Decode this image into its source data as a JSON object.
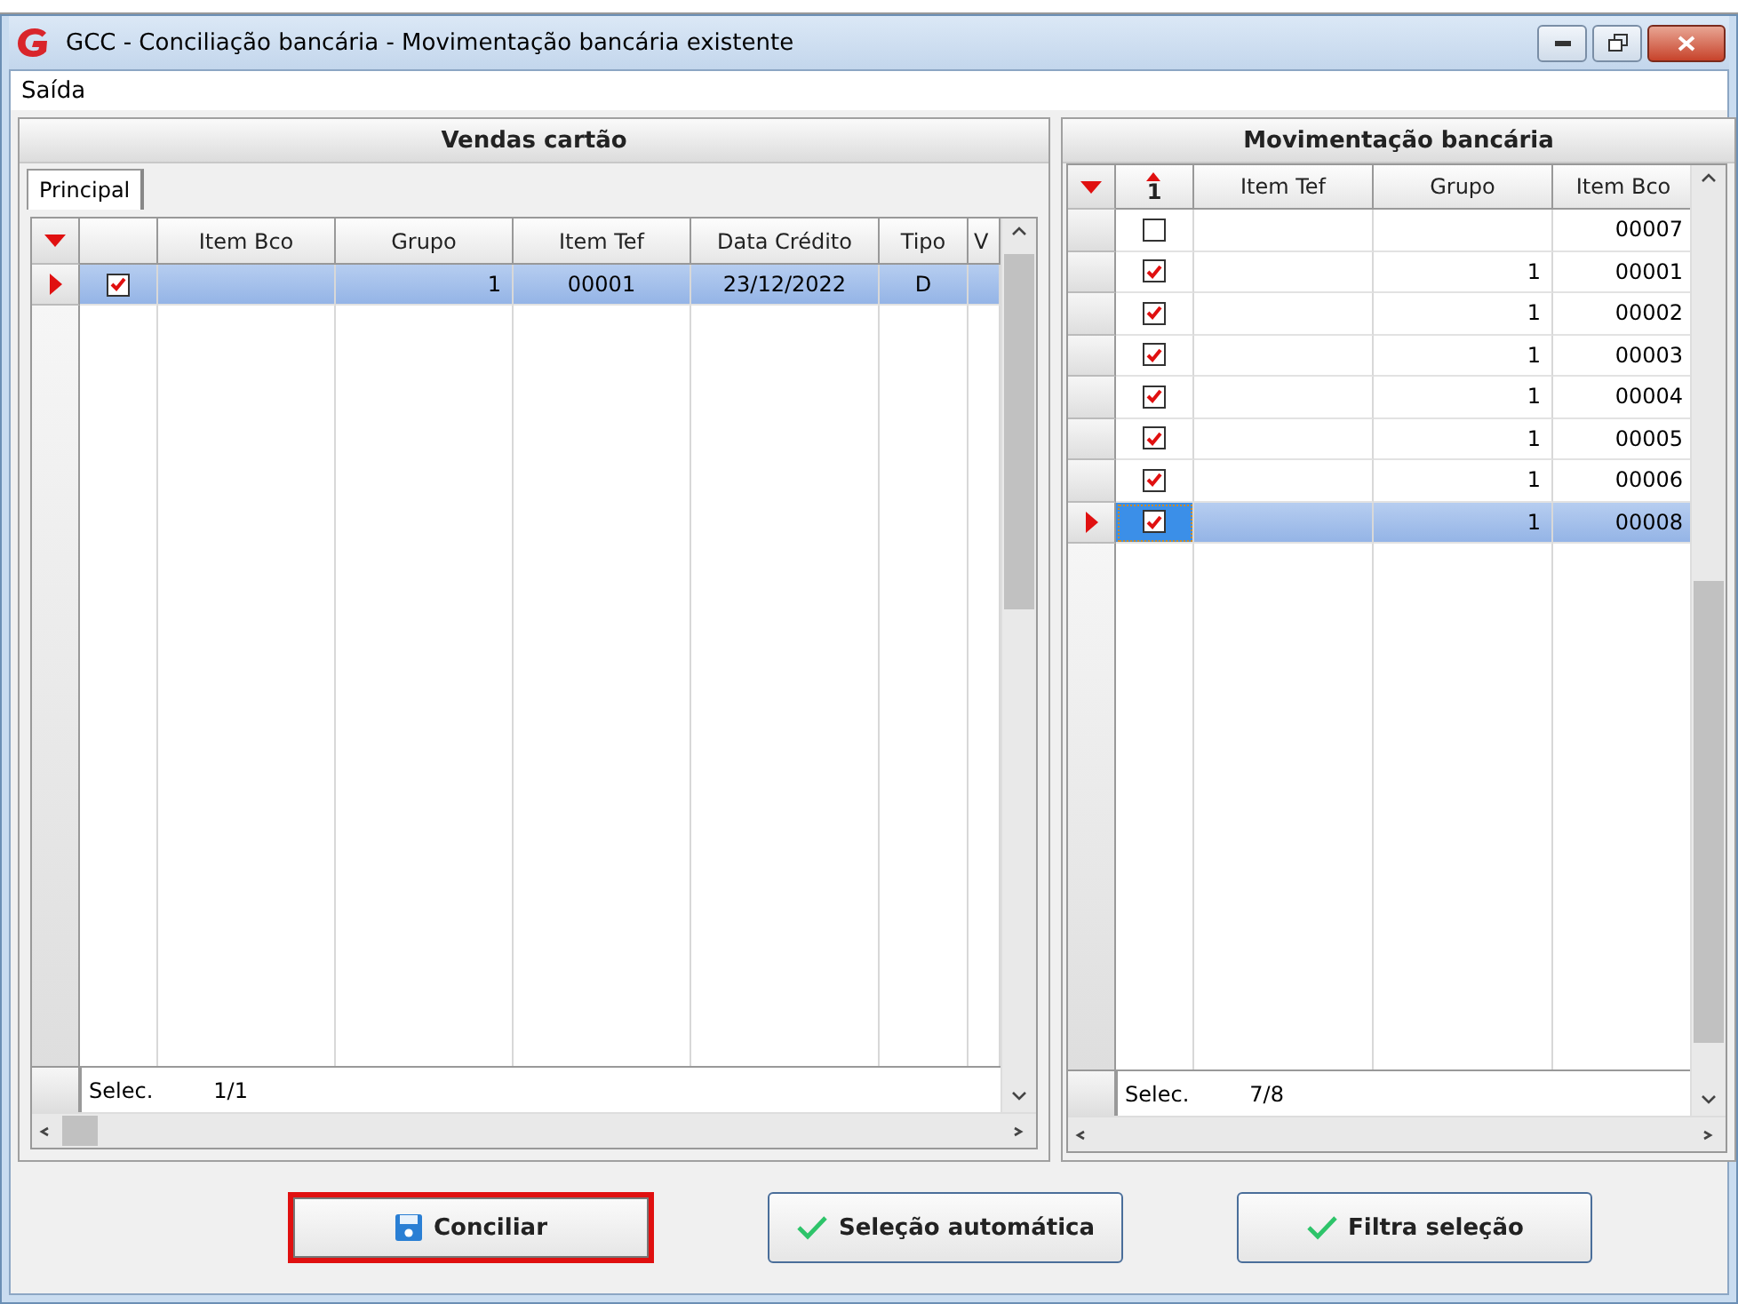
{
  "window": {
    "title": "GCC - Conciliação bancária - Movimentação bancária existente"
  },
  "menu": [
    {
      "label": "Saída"
    }
  ],
  "left_panel": {
    "title": "Vendas cartão",
    "tabs": [
      {
        "label": "Principal",
        "selected": true
      }
    ],
    "columns": [
      "Item Bco",
      "Grupo",
      "Item Tef",
      "Data Crédito",
      "Tipo",
      "V"
    ],
    "rows": [
      {
        "checked": true,
        "selected": true,
        "cells": [
          "",
          "1",
          "00001",
          "23/12/2022",
          "D",
          ""
        ]
      }
    ],
    "footer_label": "Selec.",
    "footer_count": "1/1"
  },
  "right_panel": {
    "title": "Movimentação bancária",
    "sort_mark": "1",
    "columns": [
      "Item Tef",
      "Grupo",
      "Item Bco"
    ],
    "rows": [
      {
        "checked": false,
        "selected": false,
        "cells": [
          "",
          "",
          "00007"
        ]
      },
      {
        "checked": true,
        "selected": false,
        "cells": [
          "",
          "1",
          "00001"
        ]
      },
      {
        "checked": true,
        "selected": false,
        "cells": [
          "",
          "1",
          "00002"
        ]
      },
      {
        "checked": true,
        "selected": false,
        "cells": [
          "",
          "1",
          "00003"
        ]
      },
      {
        "checked": true,
        "selected": false,
        "cells": [
          "",
          "1",
          "00004"
        ]
      },
      {
        "checked": true,
        "selected": false,
        "cells": [
          "",
          "1",
          "00005"
        ]
      },
      {
        "checked": true,
        "selected": false,
        "cells": [
          "",
          "1",
          "00006"
        ]
      },
      {
        "checked": true,
        "selected": true,
        "cells": [
          "",
          "1",
          "00008"
        ]
      }
    ],
    "footer_label": "Selec.",
    "footer_count": "7/8"
  },
  "buttons": [
    {
      "label": "Conciliar",
      "kind": "save",
      "highlighted": true
    },
    {
      "label": "Seleção automática",
      "kind": "check",
      "highlighted": false
    },
    {
      "label": "Filtra seleção",
      "kind": "check",
      "highlighted": false
    }
  ]
}
